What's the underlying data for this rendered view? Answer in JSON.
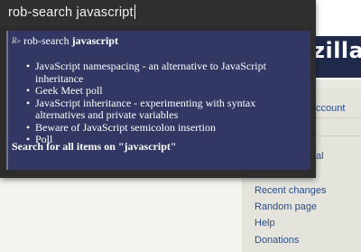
{
  "query": {
    "text": "rob-search javascript"
  },
  "results": {
    "header_prefix": "rob-search",
    "header_term": "javascript",
    "icon_glyph": "R»",
    "items": [
      {
        "label": "JavaScript namespacing - an alternative to JavaScript inheritance"
      },
      {
        "label": "Geek Meet poll"
      },
      {
        "label": "JavaScript inheritance - experimenting with syntax alternatives and private variables"
      },
      {
        "label": "Beware of JavaScript semicolon insertion"
      },
      {
        "label": "Poll"
      }
    ],
    "search_all": "Search for all items on \"javascript\""
  },
  "background": {
    "brand": "zilla",
    "sidebar_fragments": [
      "ccount",
      "al"
    ],
    "nav": [
      "Recent changes",
      "Random page",
      "Help",
      "Donations"
    ]
  }
}
